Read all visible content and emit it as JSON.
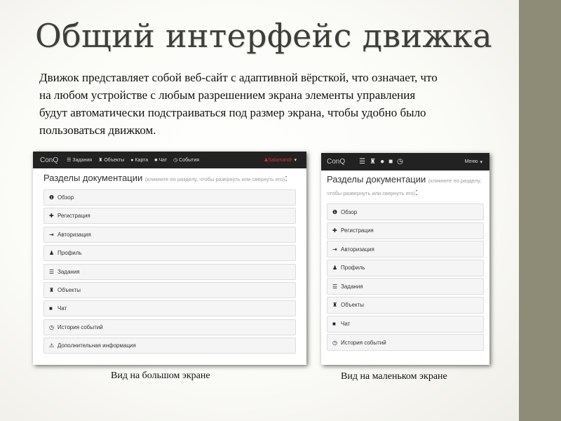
{
  "slide": {
    "title": "Общий интерфейс движка",
    "body": "Движок представляет собой веб-сайт с адаптивной вёрсткой, что означает, что на любом устройстве с любым разрешением экрана элементы управления будут автоматически подстраиваться под размер экрана, чтобы удобно было пользоваться движком.",
    "caption_large": "Вид на большом экране",
    "caption_small": "Вид на маленьком экране",
    "accent_color": "#8e8b76"
  },
  "large_view": {
    "brand": "ConQ",
    "nav": [
      {
        "icon": "tasks-icon",
        "label": "Задания"
      },
      {
        "icon": "chess-rook-icon",
        "label": "Объекты"
      },
      {
        "icon": "globe-icon",
        "label": "Карта"
      },
      {
        "icon": "comment-icon",
        "label": "Чат"
      },
      {
        "icon": "clock-icon",
        "label": "События"
      }
    ],
    "user_label": "Salamandr",
    "heading": "Разделы документации",
    "heading_hint": "(кликните по разделу, чтобы разернуть или свернуть его)",
    "heading_end": ":",
    "sections": [
      {
        "icon": "info-icon",
        "label": "Обзор"
      },
      {
        "icon": "plus-icon",
        "label": "Регистрация"
      },
      {
        "icon": "login-icon",
        "label": "Авторизация"
      },
      {
        "icon": "user-icon",
        "label": "Профиль"
      },
      {
        "icon": "tasks-icon",
        "label": "Задания"
      },
      {
        "icon": "chess-rook-icon",
        "label": "Объекты"
      },
      {
        "icon": "comment-icon",
        "label": "Чат"
      },
      {
        "icon": "clock-icon",
        "label": "История событий"
      },
      {
        "icon": "warning-icon",
        "label": "Дополнительная информация"
      }
    ]
  },
  "small_view": {
    "brand": "ConQ",
    "nav_icons": [
      "tasks-icon",
      "chess-rook-icon",
      "globe-icon",
      "comment-icon",
      "clock-icon"
    ],
    "menu_label": "Меню",
    "heading": "Разделы документации",
    "heading_hint": "(кликните по разделу, чтобы развернуть или свернуть его)",
    "heading_end": ":",
    "sections": [
      {
        "icon": "info-icon",
        "label": "Обзор"
      },
      {
        "icon": "plus-icon",
        "label": "Регистрация"
      },
      {
        "icon": "login-icon",
        "label": "Авторизация"
      },
      {
        "icon": "user-icon",
        "label": "Профиль"
      },
      {
        "icon": "tasks-icon",
        "label": "Задания"
      },
      {
        "icon": "chess-rook-icon",
        "label": "Объекты"
      },
      {
        "icon": "comment-icon",
        "label": "Чат"
      },
      {
        "icon": "clock-icon",
        "label": "История событий"
      }
    ]
  }
}
